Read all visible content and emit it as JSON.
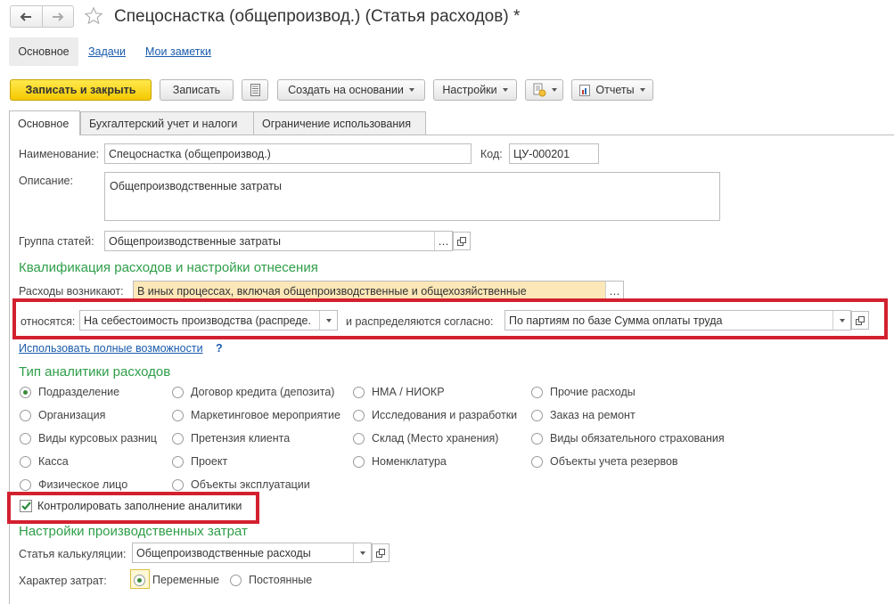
{
  "window": {
    "title": "Спецоснастка (общепроизвод.) (Статья расходов) *"
  },
  "nav": {
    "back_icon": "arrow-left-icon",
    "forward_icon": "arrow-right-icon",
    "favorite_icon": "star-icon"
  },
  "panel": {
    "main": "Основное",
    "tasks": "Задачи",
    "notes": "Мои заметки"
  },
  "toolbar": {
    "save_close": "Записать и закрыть",
    "save": "Записать",
    "create_based": "Создать на основании",
    "settings": "Настройки",
    "reports": "Отчеты"
  },
  "tabs": [
    {
      "label": "Основное"
    },
    {
      "label": "Бухгалтерский учет и налоги"
    },
    {
      "label": "Ограничение использования"
    }
  ],
  "form": {
    "name_label": "Наименование:",
    "name_value": "Спецоснастка (общепроизвод.)",
    "code_label": "Код:",
    "code_value": "ЦУ-000201",
    "desc_label": "Описание:",
    "desc_value": "Общепроизводственные затраты",
    "group_label": "Группа статей:",
    "group_value": "Общепроизводственные затраты",
    "section_qual": "Квалификация расходов и настройки отнесения",
    "arise_label": "Расходы возникают:",
    "arise_value": "В иных процессах, включая общепроизводственные и общехозяйственные",
    "relate_label": "относятся:",
    "relate_value": "На себестоимость производства (распреде.",
    "distr_label": "и распределяются согласно:",
    "distr_value": "По партиям по базе Сумма оплаты труда",
    "full_link": "Использовать полные возможности",
    "help": "?",
    "section_analytics": "Тип аналитики расходов",
    "analytics": [
      {
        "label": "Подразделение",
        "checked": true
      },
      {
        "label": "Договор кредита (депозита)",
        "checked": false
      },
      {
        "label": "НМА / НИОКР",
        "checked": false
      },
      {
        "label": "Прочие расходы",
        "checked": false
      },
      {
        "label": "Организация",
        "checked": false
      },
      {
        "label": "Маркетинговое мероприятие",
        "checked": false
      },
      {
        "label": "Исследования и разработки",
        "checked": false
      },
      {
        "label": "Заказ на ремонт",
        "checked": false
      },
      {
        "label": "Виды курсовых разниц",
        "checked": false
      },
      {
        "label": "Претензия клиента",
        "checked": false
      },
      {
        "label": "Склад (Место хранения)",
        "checked": false
      },
      {
        "label": "Виды обязательного страхования",
        "checked": false
      },
      {
        "label": "Касса",
        "checked": false
      },
      {
        "label": "Проект",
        "checked": false
      },
      {
        "label": "Номенклатура",
        "checked": false
      },
      {
        "label": "Объекты учета резервов",
        "checked": false
      },
      {
        "label": "Физическое лицо",
        "checked": false
      },
      {
        "label": "Объекты эксплуатации",
        "checked": false
      }
    ],
    "control_check": "Контролировать заполнение аналитики",
    "control_checked": true,
    "section_prod": "Настройки производственных затрат",
    "calc_label": "Статья калькуляции:",
    "calc_value": "Общепроизводственные расходы",
    "nature_label": "Характер затрат:",
    "nature_options": [
      {
        "label": "Переменные",
        "checked": true
      },
      {
        "label": "Постоянные",
        "checked": false
      }
    ]
  }
}
